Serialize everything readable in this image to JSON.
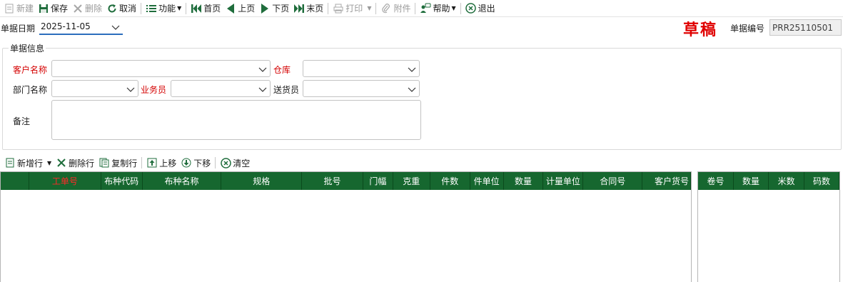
{
  "toolbar": {
    "new": "新建",
    "save": "保存",
    "delete": "删除",
    "cancel": "取消",
    "functions": "功能",
    "first": "首页",
    "prev": "上页",
    "next": "下页",
    "last": "末页",
    "print": "打印",
    "attachment": "附件",
    "help": "帮助",
    "exit": "退出"
  },
  "header": {
    "date_label": "单据日期",
    "date_value": "2025-11-05",
    "status": "草稿",
    "docno_label": "单据编号",
    "docno_value": "PRR25110501"
  },
  "form": {
    "group_title": "单据信息",
    "customer_label": "客户名称",
    "warehouse_label": "仓库",
    "dept_label": "部门名称",
    "salesman_label": "业务员",
    "delivery_label": "送货员",
    "remark_label": "备注"
  },
  "detail_toolbar": {
    "add_row": "新增行",
    "delete_row": "删除行",
    "copy_row": "复制行",
    "move_up": "上移",
    "move_down": "下移",
    "clear": "清空"
  },
  "main_grid": {
    "columns": [
      "工单号",
      "布种代码",
      "布种名称",
      "规格",
      "批号",
      "门幅",
      "克重",
      "件数",
      "件单位",
      "数量",
      "计量单位",
      "合同号",
      "客户货号"
    ]
  },
  "side_grid": {
    "columns": [
      "卷号",
      "数量",
      "米数",
      "码数"
    ]
  },
  "colors": {
    "grid_header": "#16672f",
    "required_label": "#d40000",
    "draft_stamp": "#e00000",
    "date_underline": "#2c6ebd"
  }
}
